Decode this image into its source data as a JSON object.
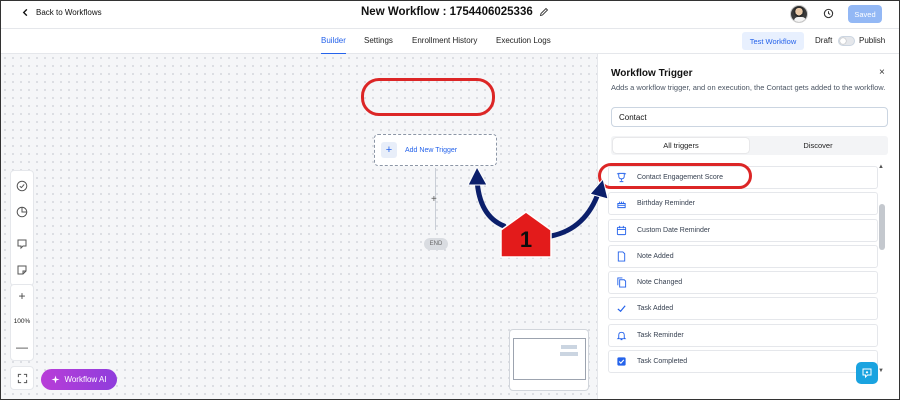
{
  "header": {
    "back_label": "Back to Workflows",
    "workflow_title": "New Workflow : 1754406025336",
    "saved_label": "Saved"
  },
  "subnav": {
    "tabs": [
      "Builder",
      "Settings",
      "Enrollment History",
      "Execution Logs"
    ],
    "active_tab": "Builder",
    "test_label": "Test Workflow",
    "draft_label": "Draft",
    "publish_label": "Publish"
  },
  "canvas": {
    "trigger_plus": "+",
    "add_trigger_label": "Add New Trigger",
    "add_step": "+",
    "end_label": "END",
    "zoom_in": "+",
    "zoom_level": "100%",
    "zoom_out": "—",
    "ai_label": "Workflow AI"
  },
  "annotation": {
    "step_number": "1",
    "color": "#dc2626",
    "arrow_color": "#0b1f6b"
  },
  "panel": {
    "title": "Workflow Trigger",
    "close": "×",
    "description": "Adds a workflow trigger, and on execution, the Contact gets added to the workflow.",
    "search_value": "Contact",
    "tabs": [
      "All triggers",
      "Discover"
    ],
    "active_tab": "All triggers",
    "items": [
      {
        "label": "Contact Engagement Score",
        "icon": "trophy-icon"
      },
      {
        "label": "Birthday Reminder",
        "icon": "cake-icon"
      },
      {
        "label": "Custom Date Reminder",
        "icon": "calendar-icon"
      },
      {
        "label": "Note Added",
        "icon": "note-icon"
      },
      {
        "label": "Note Changed",
        "icon": "note-copy-icon"
      },
      {
        "label": "Task Added",
        "icon": "check-icon"
      },
      {
        "label": "Task Reminder",
        "icon": "bell-icon"
      },
      {
        "label": "Task Completed",
        "icon": "checkbox-icon"
      }
    ]
  },
  "colors": {
    "accent": "#2563eb",
    "saved_button": "#93b8f5",
    "ai_gradient_start": "#b83dd8",
    "ai_gradient_end": "#8f3ddc",
    "help_button": "#1aa3e0"
  }
}
